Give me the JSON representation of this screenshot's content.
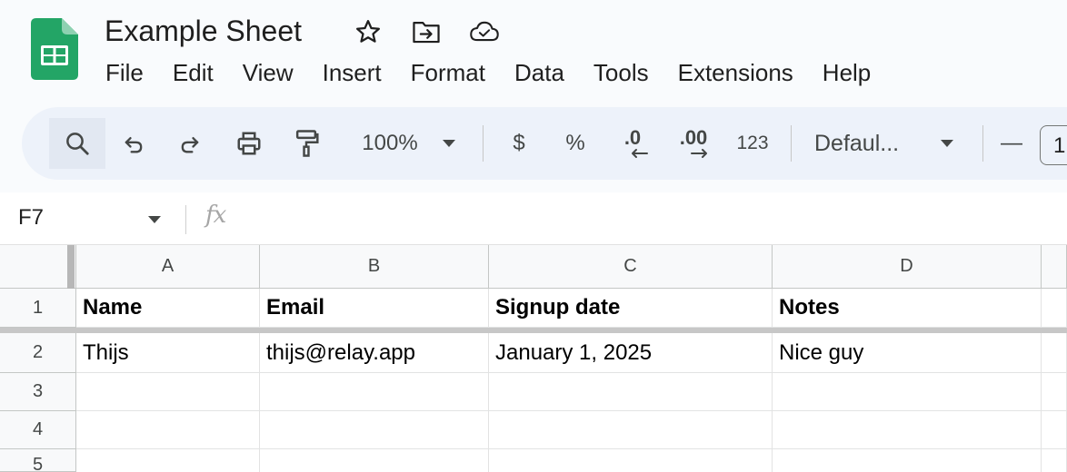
{
  "document": {
    "title": "Example Sheet"
  },
  "colors": {
    "logo_green": "#23a566",
    "accent_icon": "#444746"
  },
  "header_icons": [
    "star-icon",
    "move-to-folder-icon",
    "cloud-saved-icon"
  ],
  "menu": {
    "items": [
      {
        "label": "File"
      },
      {
        "label": "Edit"
      },
      {
        "label": "View"
      },
      {
        "label": "Insert"
      },
      {
        "label": "Format"
      },
      {
        "label": "Data"
      },
      {
        "label": "Tools"
      },
      {
        "label": "Extensions"
      },
      {
        "label": "Help"
      }
    ]
  },
  "toolbar": {
    "zoom": "100%",
    "currency": "$",
    "percent": "%",
    "decrease_decimal": ".0",
    "increase_decimal": ".00",
    "more_formats": "123",
    "font": "Defaul...",
    "minus": "—",
    "font_size_partial": "1"
  },
  "formula_bar": {
    "name_box": "F7",
    "fx": "fx"
  },
  "grid": {
    "columns": [
      {
        "label": "A"
      },
      {
        "label": "B"
      },
      {
        "label": "C"
      },
      {
        "label": "D"
      }
    ],
    "rows": [
      {
        "num": "1",
        "cells": [
          "Name",
          "Email",
          "Signup date",
          "Notes",
          ""
        ]
      },
      {
        "num": "2",
        "cells": [
          "Thijs",
          "thijs@relay.app",
          "January 1, 2025",
          "Nice guy",
          ""
        ]
      },
      {
        "num": "3",
        "cells": [
          "",
          "",
          "",
          "",
          ""
        ]
      },
      {
        "num": "4",
        "cells": [
          "",
          "",
          "",
          "",
          ""
        ]
      },
      {
        "num": "5",
        "cells": [
          "",
          "",
          "",
          "",
          ""
        ]
      }
    ]
  }
}
